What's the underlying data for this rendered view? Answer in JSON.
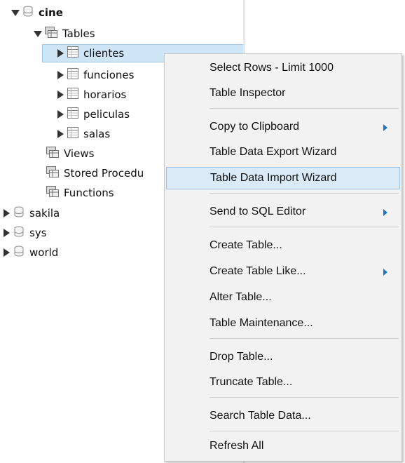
{
  "tree": {
    "schemas": [
      {
        "name": "cine",
        "expanded": true
      },
      {
        "name": "sakila",
        "expanded": false
      },
      {
        "name": "sys",
        "expanded": false
      },
      {
        "name": "world",
        "expanded": false
      }
    ],
    "tables_folder": "Tables",
    "tables": [
      "clientes",
      "funciones",
      "horarios",
      "peliculas",
      "salas"
    ],
    "selected_table": "clientes",
    "views_folder": "Views",
    "stored_procedures_folder": "Stored Procedu",
    "functions_folder": "Functions"
  },
  "context_menu": {
    "items": [
      {
        "label": "Select Rows - Limit 1000",
        "submenu": false
      },
      {
        "label": "Table Inspector",
        "submenu": false
      },
      {
        "label": "Copy to Clipboard",
        "submenu": true
      },
      {
        "label": "Table Data Export Wizard",
        "submenu": false
      },
      {
        "label": "Table Data Import Wizard",
        "submenu": false,
        "highlighted": true
      },
      {
        "label": "Send to SQL Editor",
        "submenu": true
      },
      {
        "label": "Create Table...",
        "submenu": false
      },
      {
        "label": "Create Table Like...",
        "submenu": true
      },
      {
        "label": "Alter Table...",
        "submenu": false
      },
      {
        "label": "Table Maintenance...",
        "submenu": false
      },
      {
        "label": "Drop Table...",
        "submenu": false
      },
      {
        "label": "Truncate Table...",
        "submenu": false
      },
      {
        "label": "Search Table Data...",
        "submenu": false
      },
      {
        "label": "Refresh All",
        "submenu": false
      }
    ]
  },
  "colors": {
    "selection_bg": "#cfe6f7",
    "menu_bg": "#f2f2f2",
    "menu_highlight": "#dbeaf7",
    "submenu_arrow": "#1e78c8"
  }
}
